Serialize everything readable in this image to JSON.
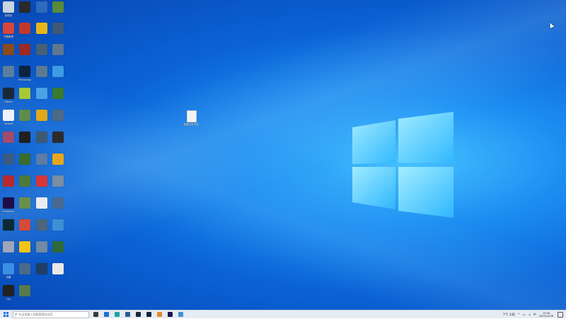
{
  "desktop": {
    "icons": [
      {
        "label": "回收站",
        "color": "#c9d4de"
      },
      {
        "label": "中国象棋",
        "color": "#d8463a"
      },
      {
        "label": "",
        "color": "#8a4a20"
      },
      {
        "label": "",
        "color": "#5b7ea0"
      },
      {
        "label": "Steam",
        "color": "#1b2838"
      },
      {
        "label": "Ubisoft",
        "color": "#eef2ff"
      },
      {
        "label": "",
        "color": "#a24b6c"
      },
      {
        "label": "",
        "color": "#3a5c84"
      },
      {
        "label": "",
        "color": "#b8292f"
      },
      {
        "label": "Premiere",
        "color": "#1e0f4b"
      },
      {
        "label": "",
        "color": "#0c2a33"
      },
      {
        "label": "",
        "color": "#a0a6b8"
      },
      {
        "label": "迅雷",
        "color": "#3b8fe3"
      },
      {
        "label": "QQ",
        "color": "#222222"
      },
      {
        "label": "",
        "color": "#2a2a2a"
      },
      {
        "label": "",
        "color": "#c0392b"
      },
      {
        "label": "",
        "color": "#9b2a24"
      },
      {
        "label": "Photoshop",
        "color": "#0c2440"
      },
      {
        "label": "",
        "color": "#a6c935"
      },
      {
        "label": "",
        "color": "#5e8c4a"
      },
      {
        "label": "",
        "color": "#202020"
      },
      {
        "label": "",
        "color": "#3a6b2f"
      },
      {
        "label": "",
        "color": "#4d7a3a"
      },
      {
        "label": "",
        "color": "#6a8f4a"
      },
      {
        "label": "",
        "color": "#d64a3a"
      },
      {
        "label": "",
        "color": "#f0c419"
      },
      {
        "label": "",
        "color": "#4a6a8a"
      },
      {
        "label": "",
        "color": "#567b4c"
      },
      {
        "label": "",
        "color": "#2f6bbd"
      },
      {
        "label": "",
        "color": "#e8b61c"
      },
      {
        "label": "",
        "color": "#456078"
      },
      {
        "label": "",
        "color": "#5a7a96"
      },
      {
        "label": "",
        "color": "#4aa3e8"
      },
      {
        "label": "",
        "color": "#e0a91a"
      },
      {
        "label": "",
        "color": "#3d5a74"
      },
      {
        "label": "",
        "color": "#5a7ca6"
      },
      {
        "label": "",
        "color": "#d6363a"
      },
      {
        "label": "",
        "color": "#e9edf2"
      },
      {
        "label": "",
        "color": "#4a6680"
      },
      {
        "label": "",
        "color": "#6f8aa2"
      },
      {
        "label": "",
        "color": "#1f3e66"
      },
      {
        "label": "",
        "color": "#5a8a3a"
      },
      {
        "label": "",
        "color": "#3e5a78"
      },
      {
        "label": "",
        "color": "#5d7892"
      },
      {
        "label": "",
        "color": "#3d9be6"
      },
      {
        "label": "",
        "color": "#3a7a32"
      },
      {
        "label": "",
        "color": "#4c6a88"
      },
      {
        "label": "",
        "color": "#2b2b2b"
      },
      {
        "label": "",
        "color": "#e8a61e"
      },
      {
        "label": "",
        "color": "#7a8ea2"
      },
      {
        "label": "",
        "color": "#4a6a92"
      },
      {
        "label": "",
        "color": "#3f8fd6"
      },
      {
        "label": "",
        "color": "#2e6a3a"
      },
      {
        "label": "",
        "color": "#e8e8e8"
      }
    ],
    "file": {
      "label": "新建文本文档"
    }
  },
  "taskbar": {
    "search_placeholder": "在这里输入你要搜索的内容",
    "pinned": [
      {
        "name": "task-view",
        "color": "#3a3a3a"
      },
      {
        "name": "explorer",
        "color": "#1f6fd6"
      },
      {
        "name": "edge",
        "color": "#1aa5a0"
      },
      {
        "name": "app-a",
        "color": "#2d5d8e"
      },
      {
        "name": "app-b",
        "color": "#1b2838"
      },
      {
        "name": "app-c",
        "color": "#0c2440"
      },
      {
        "name": "app-d",
        "color": "#e08a2a"
      },
      {
        "name": "app-e",
        "color": "#1e0f4b"
      },
      {
        "name": "app-f",
        "color": "#3f8fd6"
      }
    ],
    "tray": {
      "weather": "7°C 大雨",
      "lang": "中",
      "time": "15:58",
      "date": "2023/12/26"
    }
  }
}
